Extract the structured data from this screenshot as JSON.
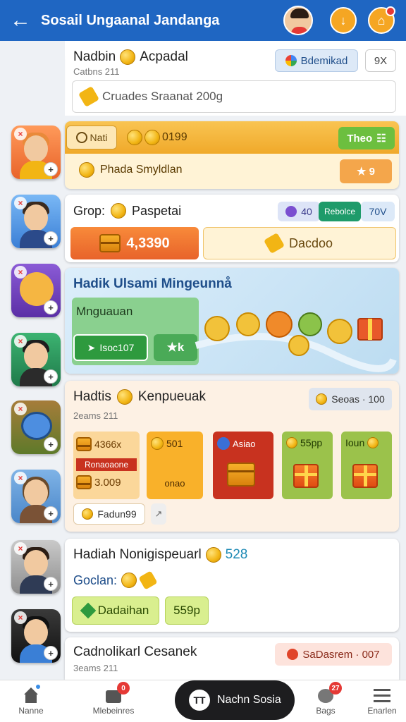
{
  "header": {
    "title": "Sosail Ungaanal Jandanga"
  },
  "profile": {
    "name": "Nadbin",
    "name_suffix": "Acpadal",
    "subtitle": "Catbns 211",
    "tag_label": "Bdemikad",
    "close_label": "9X",
    "search_text": "Cruades Sraanat 200g"
  },
  "row1": {
    "tab_label": "Nati",
    "coins_value": "0199",
    "action_label": "Theo",
    "sub_label": "Phada Smyldlan",
    "star_value": "9"
  },
  "row2": {
    "title": "Grop:",
    "title_suffix": "Paspetai",
    "count": "40",
    "tag_label": "Rebolce",
    "tag_value": "70V",
    "left_value": "4,3390",
    "right_label": "Dacdoo"
  },
  "row3": {
    "title": "Hadik Ulsami Mingeunnå",
    "panel_title": "Mnguauan",
    "btn_left": "Isoc107",
    "btn_right": "k"
  },
  "row4": {
    "title": "Hadtis",
    "title_suffix": "Kenpueuak",
    "subtitle": "2eams 211",
    "badge_label": "Seoas · 100",
    "tile1_top": "4366x",
    "tile1_mid": "Ronaoaone",
    "tile1_bottom": "3.009",
    "tile2_top": "501",
    "tile2_bottom": "onao",
    "tile3_top": "Asiao",
    "tile4_top": "55pp",
    "tile5_top": "Ioun",
    "footer_label": "Fadun99"
  },
  "row5": {
    "title": "Hadiah Nonigispeuarl",
    "title_value": "528",
    "subtitle": "Goclan:",
    "btn_left": "Dadaihan",
    "btn_right": "559p"
  },
  "row6": {
    "title": "Cadnolikarl Cesanek",
    "subtitle": "3eams 211",
    "badge_label": "SaDasrem · 007"
  },
  "nav": {
    "home_label": "Nanne",
    "members_label": "Mlebeinres",
    "members_badge": "0",
    "center_label": "Nachn Sosia",
    "center_logo": "TT",
    "bags_label": "Bags",
    "bags_badge": "27",
    "menu_label": "Enarlen"
  },
  "colors": {
    "header_blue": "#1f66c2",
    "accent_orange": "#f5a623",
    "accent_green": "#4caf50",
    "light_blue_panel": "#d6eaf6"
  }
}
